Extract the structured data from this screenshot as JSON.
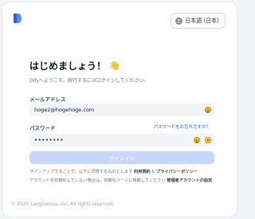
{
  "header": {
    "language_label": "日本語 (日本)"
  },
  "login": {
    "title": "はじめましょう！",
    "title_emoji": "👋",
    "subtitle": "Difyへようこそ。続行するにはログインしてください。",
    "email_label": "メールアドレス",
    "email_value": "hoge2@hogehoge.com",
    "password_label": "パスワード",
    "forgot_link": "パスワードをお忘れですか？",
    "password_value": "••••••••",
    "signin_label": "サインイン"
  },
  "terms": {
    "line1_prefix": "サインアップすることで、以下に同意するものとします",
    "terms_link": "利用規約",
    "and": " & ",
    "privacy_link": "プライバシーポリシー",
    "line2_prefix": "アカウントを初期化していない場合は、初期化ページに移動してください",
    "admin_link": "管理者アカウントの設定"
  },
  "footer": {
    "copyright": "© 2025 LangGenius, Inc. All rights reserved."
  },
  "colors": {
    "accent": "#155eef",
    "button_disabled": "#c7d7fe",
    "field_bg": "#f2f4f7",
    "icon_badge": "#f5b800"
  },
  "icons": {
    "logo": "dify-logo-icon",
    "language": "globe-icon",
    "email_field": "keyboard-assist-icon",
    "password_field": "keyboard-assist-icon",
    "password_toggle": "show-password-icon"
  }
}
